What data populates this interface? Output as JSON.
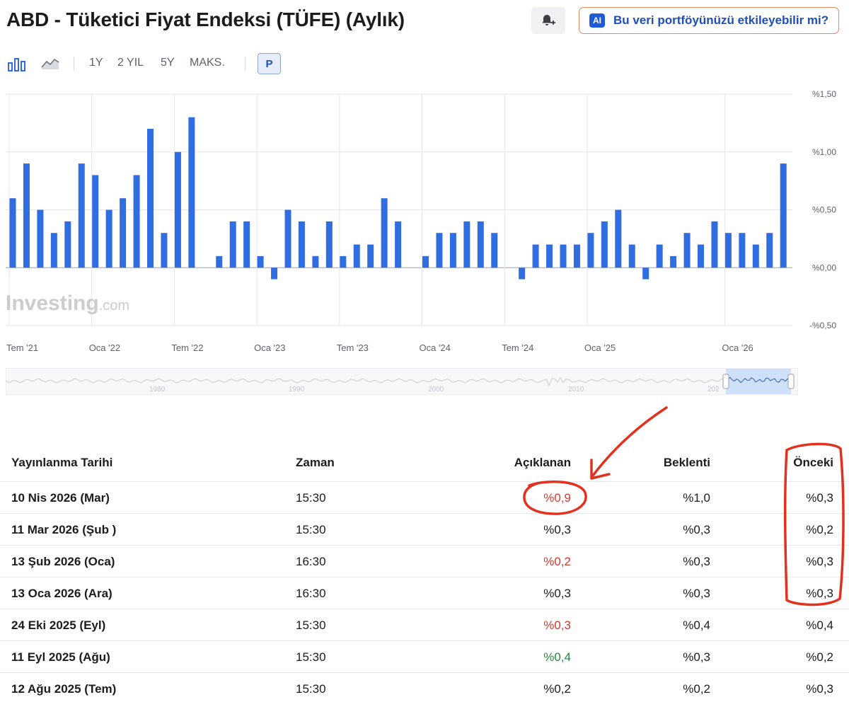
{
  "header": {
    "title": "ABD - Tüketici Fiyat Endeksi (TÜFE) (Aylık)",
    "ai_badge": "AI",
    "ai_button_label": "Bu veri portföyünüzü etkileyebilir mi?"
  },
  "toolbar": {
    "ranges": [
      "1Y",
      "2 YIL",
      "5Y",
      "MAKS."
    ],
    "p_button": "P"
  },
  "chart_data": {
    "type": "bar",
    "ylim": [
      -0.5,
      1.5
    ],
    "y_ticks": [
      1.5,
      1.0,
      0.5,
      0.0,
      -0.5
    ],
    "y_tick_labels": [
      "%1,50",
      "%1,00",
      "%0,50",
      "%0,00",
      "-%0,50"
    ],
    "x_tick_labels": [
      "Tem '21",
      "Oca '22",
      "Tem '22",
      "Oca '23",
      "Tem '23",
      "Oca '24",
      "Tem '24",
      "Oca '25",
      "Oca '26"
    ],
    "x_tick_index": [
      0,
      6,
      12,
      18,
      24,
      30,
      36,
      42,
      52
    ],
    "values": [
      0.6,
      0.9,
      0.5,
      0.3,
      0.4,
      0.9,
      0.8,
      0.5,
      0.6,
      0.8,
      1.2,
      0.3,
      1.0,
      1.3,
      0.0,
      0.1,
      0.4,
      0.4,
      0.1,
      -0.1,
      0.5,
      0.4,
      0.1,
      0.4,
      0.1,
      0.2,
      0.2,
      0.6,
      0.4,
      0.0,
      0.1,
      0.3,
      0.3,
      0.4,
      0.4,
      0.3,
      0.0,
      -0.1,
      0.2,
      0.2,
      0.2,
      0.2,
      0.3,
      0.4,
      0.5,
      0.2,
      -0.1,
      0.2,
      0.1,
      0.3,
      0.2,
      0.4,
      0.3,
      0.3,
      0.2,
      0.3,
      0.9
    ],
    "bar_color": "#2f6de1"
  },
  "watermark": {
    "main": "Investing",
    "suffix": ".com"
  },
  "navigator": {
    "labels": [
      "1980",
      "1990",
      "2000",
      "2010",
      "202"
    ]
  },
  "table": {
    "headers": {
      "date": "Yayınlanma Tarihi",
      "time": "Zaman",
      "actual": "Açıklanan",
      "forecast": "Beklenti",
      "previous": "Önceki"
    },
    "rows": [
      {
        "date": "10 Nis 2026 (Mar)",
        "time": "15:30",
        "actual": "%0,9",
        "actual_status": "red",
        "forecast": "%1,0",
        "previous": "%0,3"
      },
      {
        "date": "11 Mar 2026 (Şub )",
        "time": "15:30",
        "actual": "%0,3",
        "actual_status": "neutral",
        "forecast": "%0,3",
        "previous": "%0,2"
      },
      {
        "date": "13 Şub 2026 (Oca)",
        "time": "16:30",
        "actual": "%0,2",
        "actual_status": "red",
        "forecast": "%0,3",
        "previous": "%0,3"
      },
      {
        "date": "13 Oca 2026 (Ara)",
        "time": "16:30",
        "actual": "%0,3",
        "actual_status": "neutral",
        "forecast": "%0,3",
        "previous": "%0,3"
      },
      {
        "date": "24 Eki 2025 (Eyl)",
        "time": "15:30",
        "actual": "%0,3",
        "actual_status": "red",
        "forecast": "%0,4",
        "previous": "%0,4"
      },
      {
        "date": "11 Eyl 2025 (Ağu)",
        "time": "15:30",
        "actual": "%0,4",
        "actual_status": "green",
        "forecast": "%0,3",
        "previous": "%0,2"
      },
      {
        "date": "12 Ağu 2025 (Tem)",
        "time": "15:30",
        "actual": "%0,2",
        "actual_status": "neutral",
        "forecast": "%0,2",
        "previous": "%0,3"
      }
    ]
  },
  "colors": {
    "accent": "#1e4fb8",
    "ai_border": "#e8875b",
    "annotation": "#e0321e",
    "negative": "#d03a2f",
    "positive": "#1f8a3c"
  }
}
